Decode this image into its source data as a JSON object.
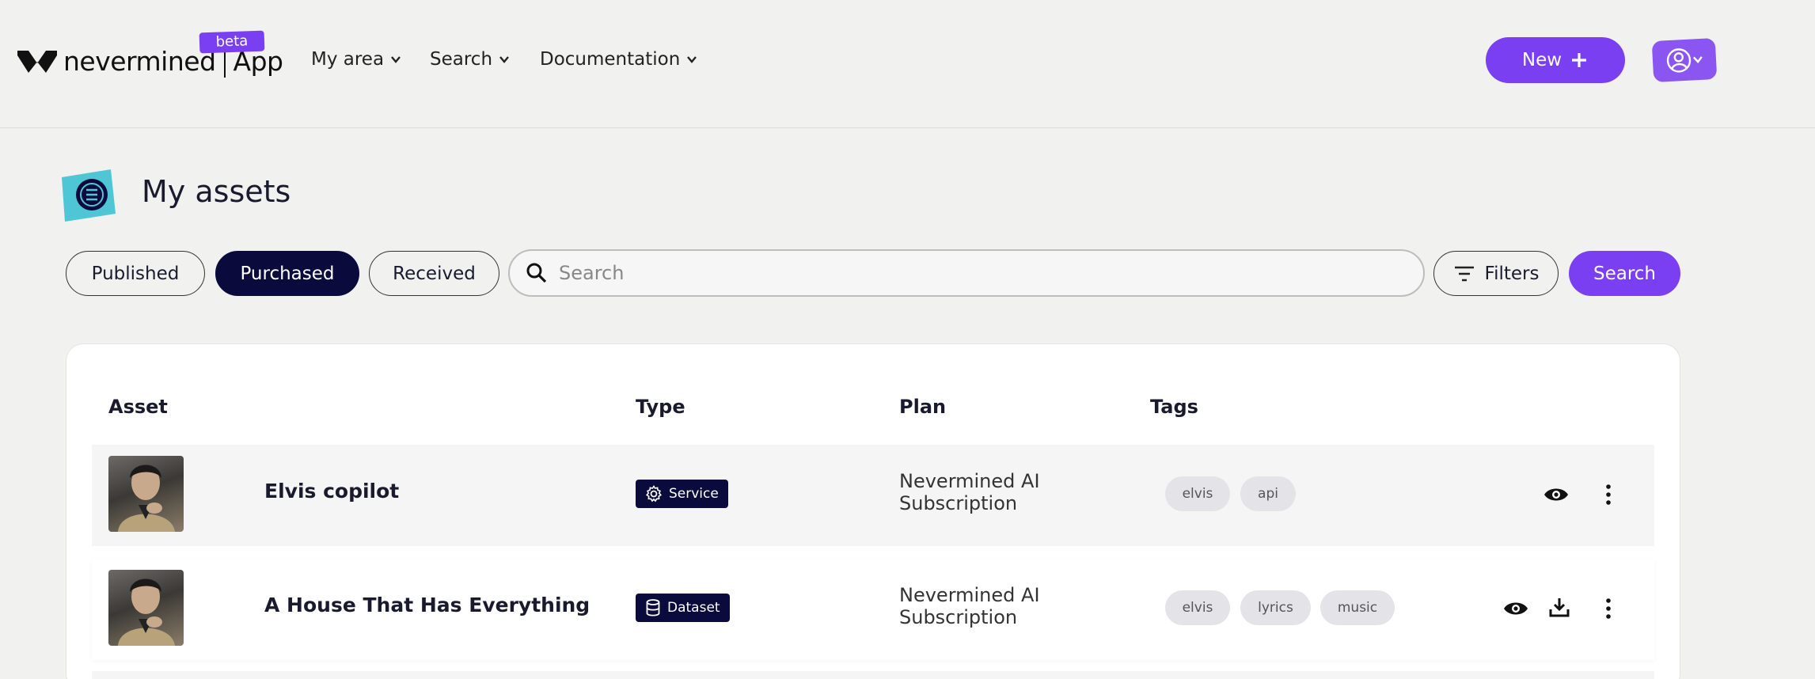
{
  "header": {
    "logo_text": "nevermined",
    "logo_app": "App",
    "beta_label": "beta",
    "nav": [
      {
        "label": "My area"
      },
      {
        "label": "Search"
      },
      {
        "label": "Documentation"
      }
    ],
    "new_button": "New"
  },
  "page": {
    "title": "My assets"
  },
  "tabs": [
    {
      "label": "Published",
      "active": false
    },
    {
      "label": "Purchased",
      "active": true
    },
    {
      "label": "Received",
      "active": false
    }
  ],
  "search": {
    "placeholder": "Search",
    "filters_label": "Filters",
    "search_button": "Search"
  },
  "table": {
    "columns": [
      "Asset",
      "Type",
      "Plan",
      "Tags"
    ],
    "rows": [
      {
        "name": "Elvis copilot",
        "type": "Service",
        "type_icon": "gear-icon",
        "plan_line1": "Nevermined AI",
        "plan_line2": "Subscription",
        "tags": [
          "elvis",
          "api"
        ],
        "actions": [
          "view-icon",
          "more-icon"
        ]
      },
      {
        "name": "A House That Has Everything",
        "type": "Dataset",
        "type_icon": "database-icon",
        "plan_line1": "Nevermined AI",
        "plan_line2": "Subscription",
        "tags": [
          "elvis",
          "lyrics",
          "music"
        ],
        "actions": [
          "view-icon",
          "download-icon",
          "more-icon"
        ]
      }
    ]
  },
  "colors": {
    "accent": "#7b3ff2",
    "navy": "#0a0a3d",
    "background": "#f1f1f0"
  }
}
